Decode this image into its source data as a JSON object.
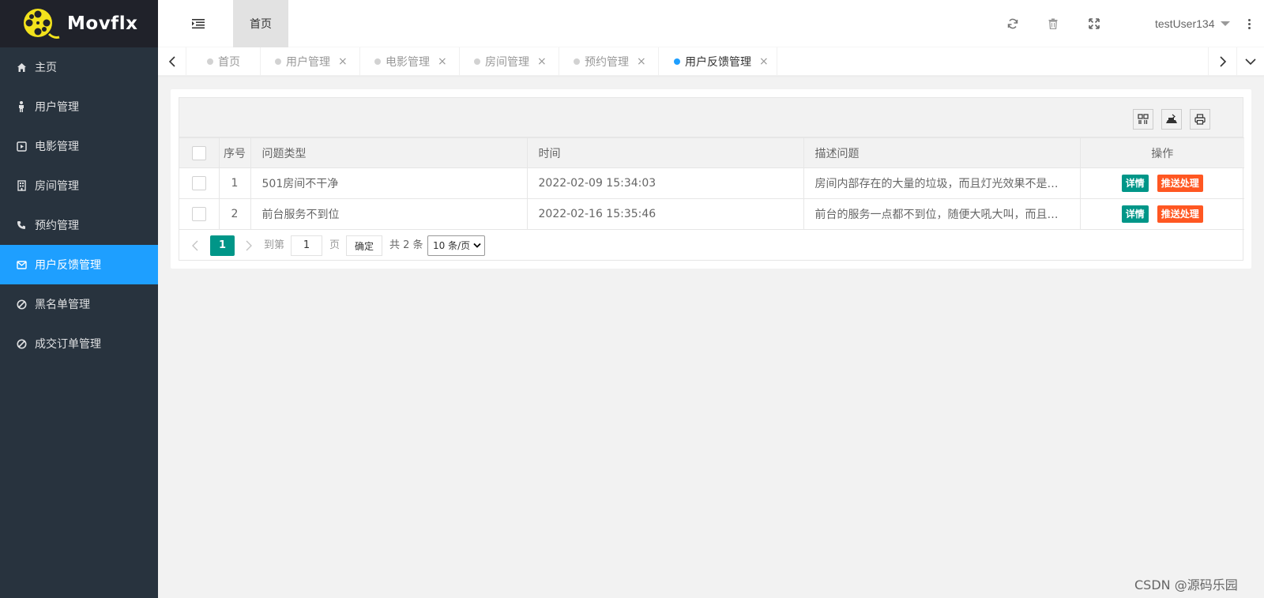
{
  "app": {
    "brand": "Movflx"
  },
  "sidebar": {
    "items": [
      {
        "label": "主页",
        "icon": "home-icon"
      },
      {
        "label": "用户管理",
        "icon": "male-icon"
      },
      {
        "label": "电影管理",
        "icon": "play-square-icon"
      },
      {
        "label": "房间管理",
        "icon": "building-icon"
      },
      {
        "label": "预约管理",
        "icon": "phone-icon"
      },
      {
        "label": "用户反馈管理",
        "icon": "envelope-icon",
        "active": true
      },
      {
        "label": "黑名单管理",
        "icon": "ban-icon"
      },
      {
        "label": "成交订单管理",
        "icon": "ban-icon"
      }
    ]
  },
  "header": {
    "home_tab": "首页",
    "user": "testUser134"
  },
  "tabs": [
    {
      "label": "首页"
    },
    {
      "label": "用户管理"
    },
    {
      "label": "电影管理"
    },
    {
      "label": "房间管理"
    },
    {
      "label": "预约管理"
    },
    {
      "label": "用户反馈管理",
      "active": true
    }
  ],
  "table": {
    "columns": [
      "序号",
      "问题类型",
      "时间",
      "描述问题",
      "操作"
    ],
    "rows": [
      {
        "idx": "1",
        "type": "501房间不干净",
        "time": "2022-02-09 15:34:03",
        "desc": "房间内部存在的大量的垃圾，而且灯光效果不是很…"
      },
      {
        "idx": "2",
        "type": "前台服务不到位",
        "time": "2022-02-16 15:35:46",
        "desc": "前台的服务一点都不到位，随便大吼大叫，而且服…"
      }
    ],
    "actions": {
      "detail": "详情",
      "push": "推送处理"
    }
  },
  "pagination": {
    "current": "1",
    "goto_label": "到第",
    "goto_value": "1",
    "page_label": "页",
    "confirm": "确定",
    "total": "共 2 条",
    "page_size": "10 条/页"
  },
  "watermark": "CSDN @源码乐园",
  "colors": {
    "sidebar": "#28333e",
    "active": "#1e9fff",
    "green": "#009688",
    "orange": "#ff5722"
  }
}
